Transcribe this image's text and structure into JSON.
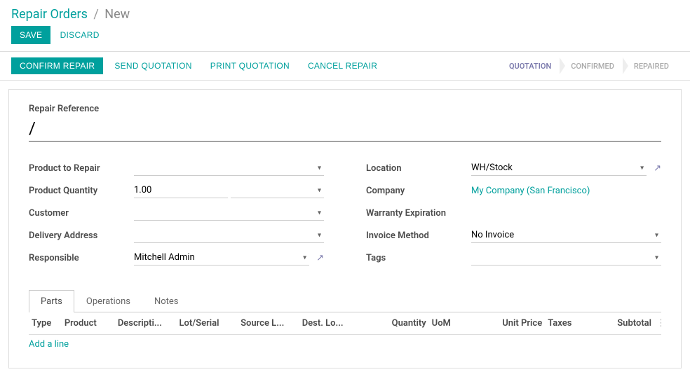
{
  "breadcrumb": {
    "parent": "Repair Orders",
    "current": "New"
  },
  "actions": {
    "save": "Save",
    "discard": "Discard"
  },
  "statusbar": {
    "confirm": "Confirm Repair",
    "send": "Send Quotation",
    "print": "Print Quotation",
    "cancel": "Cancel Repair",
    "steps": {
      "quotation": "Quotation",
      "confirmed": "Confirmed",
      "repaired": "Repaired"
    }
  },
  "form": {
    "reference": {
      "label": "Repair Reference",
      "value": "/"
    },
    "left": {
      "product_to_repair": {
        "label": "Product to Repair",
        "value": ""
      },
      "product_quantity": {
        "label": "Product Quantity",
        "value": "1.00",
        "uom": ""
      },
      "customer": {
        "label": "Customer",
        "value": ""
      },
      "delivery_address": {
        "label": "Delivery Address",
        "value": ""
      },
      "responsible": {
        "label": "Responsible",
        "value": "Mitchell Admin"
      }
    },
    "right": {
      "location": {
        "label": "Location",
        "value": "WH/Stock"
      },
      "company": {
        "label": "Company",
        "value": "My Company (San Francisco)"
      },
      "warranty": {
        "label": "Warranty Expiration",
        "value": ""
      },
      "invoice_method": {
        "label": "Invoice Method",
        "value": "No Invoice"
      },
      "tags": {
        "label": "Tags",
        "value": ""
      }
    }
  },
  "tabs": {
    "parts": "Parts",
    "operations": "Operations",
    "notes": "Notes"
  },
  "table": {
    "headers": {
      "type": "Type",
      "product": "Product",
      "description": "Descripti...",
      "lot": "Lot/Serial",
      "source": "Source L...",
      "dest": "Dest. Lo...",
      "quantity": "Quantity",
      "uom": "UoM",
      "unit_price": "Unit Price",
      "taxes": "Taxes",
      "subtotal": "Subtotal"
    },
    "add_line": "Add a line"
  }
}
